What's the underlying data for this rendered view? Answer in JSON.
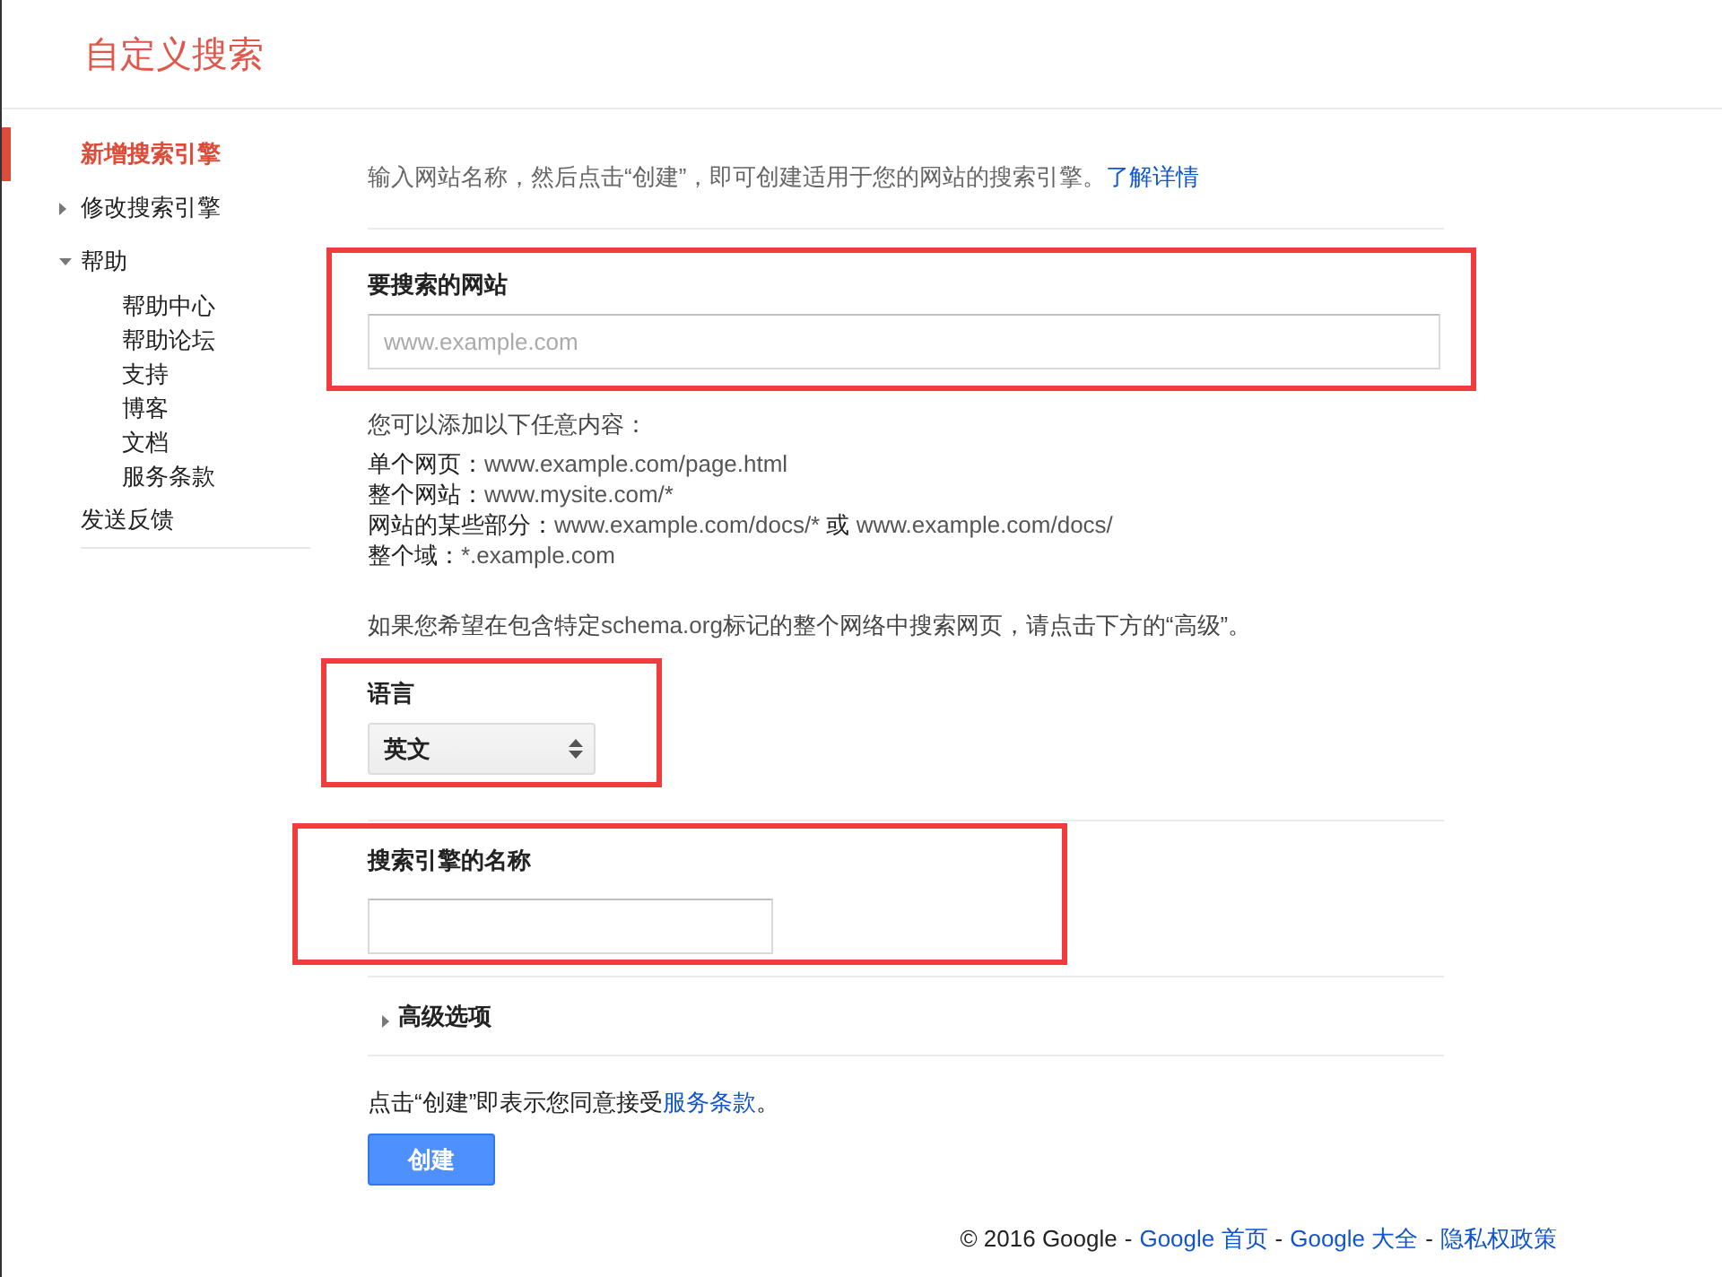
{
  "header": {
    "title": "自定义搜索"
  },
  "sidebar": {
    "items": [
      {
        "kind": "link",
        "label": "新增搜索引擎",
        "selected": true
      },
      {
        "kind": "group",
        "label": "修改搜索引擎",
        "selected": false,
        "expanded": false
      },
      {
        "kind": "group",
        "label": "帮助",
        "selected": false,
        "expanded": true,
        "children": [
          {
            "label": "帮助中心",
            "selected": false
          },
          {
            "label": "帮助论坛",
            "selected": false
          },
          {
            "label": "支持",
            "selected": false
          },
          {
            "label": "博客",
            "selected": false
          },
          {
            "label": "文档",
            "selected": false
          },
          {
            "label": "服务条款",
            "selected": false
          }
        ]
      },
      {
        "kind": "link",
        "label": "发送反馈",
        "selected": false
      }
    ]
  },
  "intro": {
    "parts": [
      {
        "kind": "text",
        "text": "输入网站名称，然后点击“创建”，即可创建适用于您的网站的搜索引擎。"
      },
      {
        "kind": "link",
        "text": "了解详情"
      }
    ]
  },
  "site_field": {
    "label": "要搜索的网站",
    "placeholder": "www.example.com",
    "highlighted": true
  },
  "examples": {
    "heading": "您可以添加以下任意内容：",
    "lines": [
      {
        "parts": [
          {
            "kind": "text",
            "text": "单个网页："
          },
          {
            "kind": "url",
            "text": "www.example.com/page.html"
          }
        ]
      },
      {
        "parts": [
          {
            "kind": "text",
            "text": "整个网站："
          },
          {
            "kind": "url",
            "text": "www.mysite.com/*"
          }
        ]
      },
      {
        "parts": [
          {
            "kind": "text",
            "text": "网站的某些部分："
          },
          {
            "kind": "url",
            "text": "www.example.com/docs/*"
          },
          {
            "kind": "text",
            "text": " 或 "
          },
          {
            "kind": "url",
            "text": "www.example.com/docs/"
          }
        ]
      },
      {
        "parts": [
          {
            "kind": "text",
            "text": "整个域："
          },
          {
            "kind": "url",
            "text": "*.example.com"
          }
        ]
      }
    ]
  },
  "schema_note": {
    "parts": [
      {
        "kind": "text",
        "text": "如果您希望在包含特定"
      },
      {
        "kind": "url",
        "text": "schema.org"
      },
      {
        "kind": "text",
        "text": "标记的整个网络中搜索网页，请点击下方的“高级”。"
      }
    ]
  },
  "language": {
    "label": "语言",
    "value": "英文",
    "highlighted": true
  },
  "engine_name": {
    "label": "搜索引擎的名称",
    "highlighted": true
  },
  "advanced": {
    "label": "高级选项",
    "expanded": false
  },
  "terms": {
    "parts": [
      {
        "kind": "text",
        "text": "点击“创建”即表示您同意接受"
      },
      {
        "kind": "link",
        "text": "服务条款"
      },
      {
        "kind": "text",
        "text": "。"
      }
    ]
  },
  "create_button": {
    "label": "创建"
  },
  "footer": {
    "parts": [
      {
        "kind": "text",
        "text": "© 2016 Google"
      },
      {
        "kind": "sep",
        "text": "-"
      },
      {
        "kind": "link",
        "text": "Google 首页"
      },
      {
        "kind": "sep",
        "text": "-"
      },
      {
        "kind": "link",
        "text": "Google 大全"
      },
      {
        "kind": "sep",
        "text": "-"
      },
      {
        "kind": "link",
        "text": "隐私权政策"
      }
    ]
  }
}
